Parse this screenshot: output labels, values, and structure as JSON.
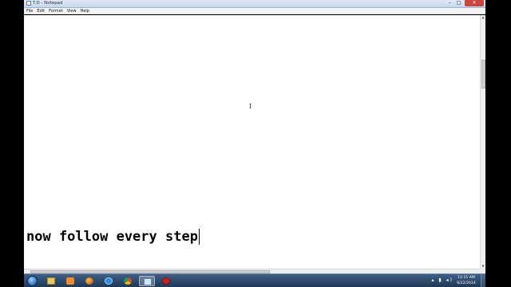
{
  "window": {
    "title": "T.D - Notepad",
    "min_glyph": "–",
    "max_glyph": "□",
    "close_glyph": "✕"
  },
  "menu": [
    "File",
    "Edit",
    "Format",
    "View",
    "Help"
  ],
  "editor": {
    "text": "now follow every step",
    "cursor_glyph": "I"
  },
  "taskbar": {
    "tray_icons": "▴ ▮ ◂)",
    "time": "11:11 AM",
    "date": "6/22/2014",
    "pinned": [
      "explorer-icon",
      "media-player-icon",
      "firefox-icon",
      "internet-explorer-icon",
      "chrome-icon",
      "notepad-icon",
      "record-icon"
    ]
  }
}
